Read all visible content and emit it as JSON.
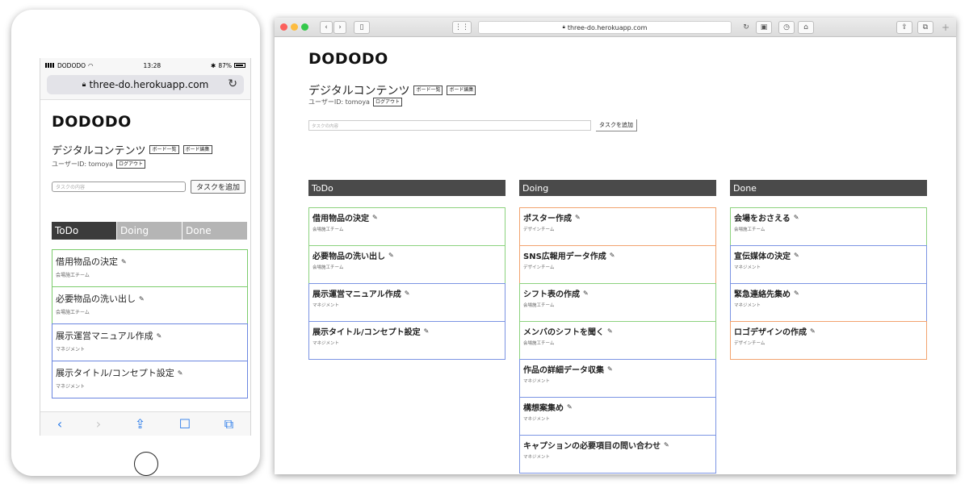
{
  "mobile": {
    "status": {
      "carrier": "DODODO",
      "time": "13:28",
      "battery": "87%"
    },
    "url": "three-do.herokuapp.com",
    "logo": "DODODO",
    "board_title": "デジタルコンテンツ",
    "board_list_btn": "ボード一覧",
    "board_edit_btn": "ボード編集",
    "user_label": "ユーザーID: tomoya",
    "logout_btn": "ログアウト",
    "task_placeholder": "タスクの内容",
    "add_task_btn": "タスクを追加",
    "tabs": [
      "ToDo",
      "Doing",
      "Done"
    ],
    "tasks": [
      {
        "title": "借用物品の決定",
        "team": "会場施工チーム",
        "color": "green"
      },
      {
        "title": "必要物品の洗い出し",
        "team": "会場施工チーム",
        "color": "green"
      },
      {
        "title": "展示運営マニュアル作成",
        "team": "マネジメント",
        "color": "blue"
      },
      {
        "title": "展示タイトル/コンセプト設定",
        "team": "マネジメント",
        "color": "blue"
      }
    ]
  },
  "desktop": {
    "url": "three-do.herokuapp.com",
    "logo": "DODODO",
    "board_title": "デジタルコンテンツ",
    "board_list_btn": "ボード一覧",
    "board_edit_btn": "ボード編集",
    "user_label": "ユーザーID: tomoya",
    "logout_btn": "ログアウト",
    "task_placeholder": "タスクの内容",
    "add_task_btn": "タスクを追加",
    "columns": [
      {
        "name": "ToDo",
        "tasks": [
          {
            "title": "借用物品の決定",
            "team": "会場施工チーム",
            "color": "green"
          },
          {
            "title": "必要物品の洗い出し",
            "team": "会場施工チーム",
            "color": "green"
          },
          {
            "title": "展示運営マニュアル作成",
            "team": "マネジメント",
            "color": "blue"
          },
          {
            "title": "展示タイトル/コンセプト設定",
            "team": "マネジメント",
            "color": "blue"
          }
        ]
      },
      {
        "name": "Doing",
        "tasks": [
          {
            "title": "ポスター作成",
            "team": "デザインチーム",
            "color": "orange"
          },
          {
            "title": "SNS広報用データ作成",
            "team": "デザインチーム",
            "color": "orange"
          },
          {
            "title": "シフト表の作成",
            "team": "会場施工チーム",
            "color": "green"
          },
          {
            "title": "メンバのシフトを聞く",
            "team": "会場施工チーム",
            "color": "green"
          },
          {
            "title": "作品の詳細データ収集",
            "team": "マネジメント",
            "color": "blue"
          },
          {
            "title": "構想案集め",
            "team": "マネジメント",
            "color": "blue"
          },
          {
            "title": "キャプションの必要項目の問い合わせ",
            "team": "マネジメント",
            "color": "blue"
          }
        ]
      },
      {
        "name": "Done",
        "tasks": [
          {
            "title": "会場をおさえる",
            "team": "会場施工チーム",
            "color": "green"
          },
          {
            "title": "宣伝媒体の決定",
            "team": "マネジメント",
            "color": "blue"
          },
          {
            "title": "緊急連絡先集め",
            "team": "マネジメント",
            "color": "blue"
          },
          {
            "title": "ロゴデザインの作成",
            "team": "デザインチーム",
            "color": "orange"
          }
        ]
      }
    ]
  },
  "colors": {
    "green": "#8cd27e",
    "blue": "#7b94e3",
    "orange": "#f2a36e",
    "header": "#4a4a4a"
  },
  "icons": [
    "wifi-icon",
    "lock-icon",
    "reload-icon",
    "pencil-icon",
    "share-icon",
    "bookmarks-icon",
    "tabs-icon"
  ]
}
